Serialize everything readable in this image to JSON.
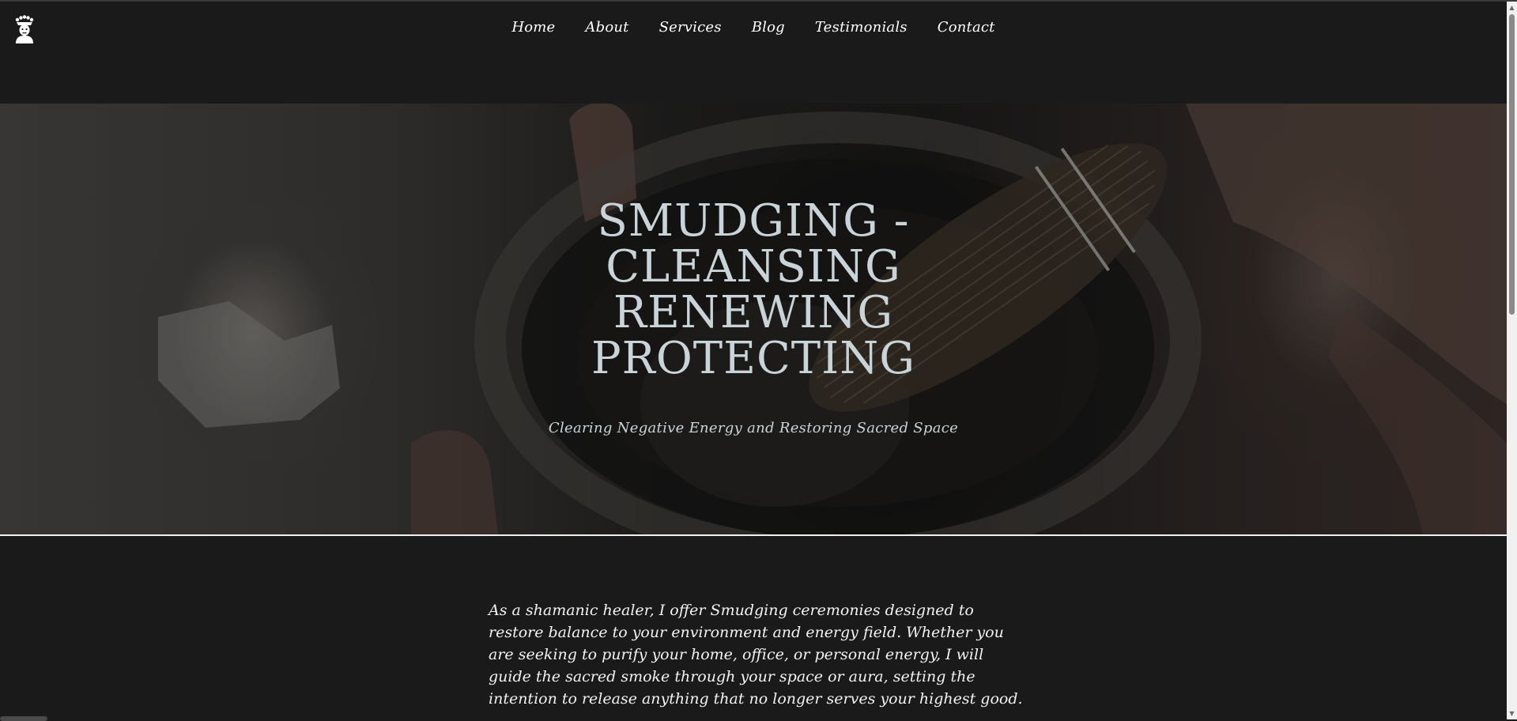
{
  "header": {
    "logo_icon": "shaman-headdress-icon",
    "nav": [
      {
        "label": "Home"
      },
      {
        "label": "About"
      },
      {
        "label": "Services"
      },
      {
        "label": "Blog"
      },
      {
        "label": "Testimonials"
      },
      {
        "label": "Contact"
      }
    ]
  },
  "hero": {
    "title": "Smudging -\nCleansing\nRenewing\nProtecting",
    "subtitle": "Clearing Negative Energy and Restoring Sacred Space",
    "image_icon": "sage-smudge-bundle-in-abalone-shell-image"
  },
  "main": {
    "intro": "As a shamanic healer, I offer Smudging ceremonies designed to restore balance to your environment and energy field. Whether you are seeking to purify your home, office, or personal energy, I will guide the sacred smoke through your space or aura, setting the intention to release anything that no longer serves your highest good."
  },
  "colors": {
    "background": "#1a1a1a",
    "hero_text": "#c9d4d8",
    "nav_text": "#ffffff"
  }
}
